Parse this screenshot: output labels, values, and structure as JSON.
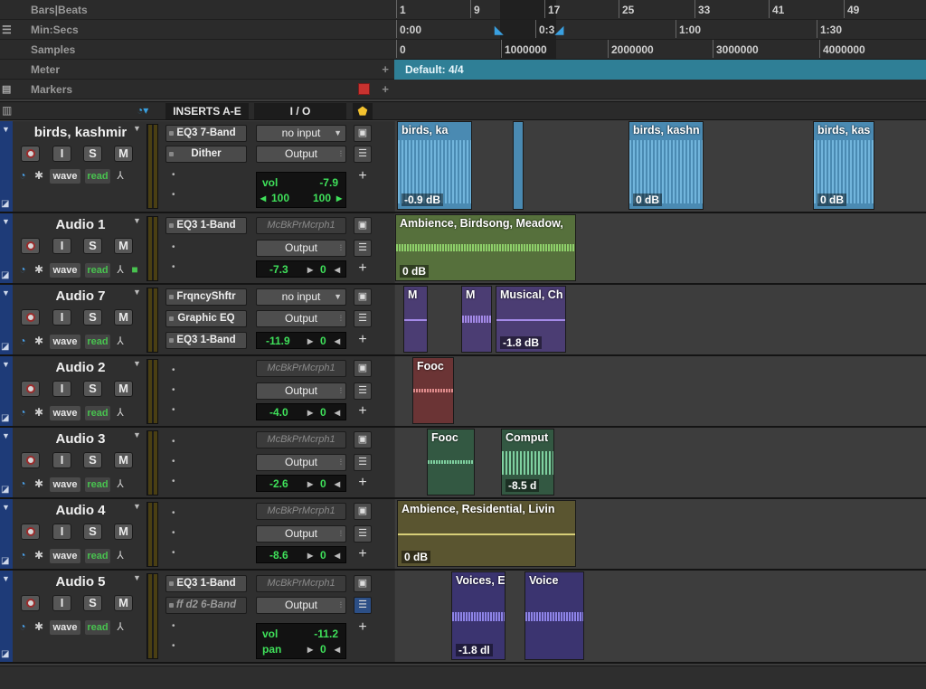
{
  "rulers": {
    "bars_beats": {
      "label": "Bars|Beats",
      "ticks": [
        "1",
        "9",
        "17",
        "25",
        "33",
        "41",
        "49"
      ]
    },
    "min_secs": {
      "label": "Min:Secs",
      "ticks": [
        "0:00",
        "0:3",
        "1:00",
        "1:30"
      ]
    },
    "samples": {
      "label": "Samples",
      "ticks": [
        "0",
        "1000000",
        "2000000",
        "3000000",
        "4000000"
      ]
    },
    "meter": {
      "label": "Meter",
      "value": "Default: 4/4"
    },
    "markers": {
      "label": "Markers"
    }
  },
  "header": {
    "inserts": "INSERTS A-E",
    "io": "I / O"
  },
  "colors": {
    "track_edge": "#1e3b78",
    "meter_bar": "#2f7f96",
    "vol_text": "#3fe05a",
    "read": "#48c34f"
  },
  "tracks": [
    {
      "name": "birds, kashmir",
      "inserts": [
        "EQ3 7-Band",
        "Dither"
      ],
      "input": "no input",
      "output": "Output",
      "vol_label": "vol",
      "vol": "-7.9",
      "pan_left": "100",
      "pan_right": "100",
      "view": "wave",
      "auto": "read",
      "clips": [
        {
          "name": "birds, ka",
          "gain": "-0.9 dB"
        },
        {
          "name": "birds, kashn",
          "gain": "0 dB"
        },
        {
          "name": "birds, kas",
          "gain": "0 dB"
        }
      ]
    },
    {
      "name": "Audio 1",
      "inserts": [
        "EQ3 1-Band"
      ],
      "input": "McBkPrMcrph1",
      "output": "Output",
      "vol": "-7.3",
      "pan": "0",
      "view": "wave",
      "auto": "read",
      "clips": [
        {
          "name": "Ambience, Birdsong, Meadow,",
          "gain": "0 dB"
        }
      ]
    },
    {
      "name": "Audio 7",
      "inserts": [
        "FrqncyShftr",
        "Graphic EQ",
        "EQ3 1-Band"
      ],
      "input": "no input",
      "output": "Output",
      "vol": "-11.9",
      "pan": "0",
      "view": "wave",
      "auto": "read",
      "clips": [
        {
          "name": "M",
          "gain": ""
        },
        {
          "name": "M",
          "gain": ""
        },
        {
          "name": "Musical, Ch",
          "gain": "-1.8 dB"
        }
      ]
    },
    {
      "name": "Audio 2",
      "inserts": [],
      "input": "McBkPrMcrph1",
      "output": "Output",
      "vol": "-4.0",
      "pan": "0",
      "view": "wave",
      "auto": "read",
      "clips": [
        {
          "name": "Fooc",
          "gain": ""
        }
      ]
    },
    {
      "name": "Audio 3",
      "inserts": [],
      "input": "McBkPrMcrph1",
      "output": "Output",
      "vol": "-2.6",
      "pan": "0",
      "view": "wave",
      "auto": "read",
      "clips": [
        {
          "name": "Fooc",
          "gain": ""
        },
        {
          "name": "Comput",
          "gain": "-8.5 d"
        }
      ]
    },
    {
      "name": "Audio 4",
      "inserts": [],
      "input": "McBkPrMcrph1",
      "output": "Output",
      "vol": "-8.6",
      "pan": "0",
      "view": "wave",
      "auto": "read",
      "clips": [
        {
          "name": "Ambience, Residential, Livin",
          "gain": "0 dB"
        }
      ]
    },
    {
      "name": "Audio 5",
      "inserts": [
        "EQ3 1-Band",
        "ff d2 6-Band"
      ],
      "input": "McBkPrMcrph1",
      "output": "Output",
      "vol_label": "vol",
      "vol": "-11.2",
      "pan_label": "pan",
      "pan": "0",
      "view": "wave",
      "auto": "read",
      "clips": [
        {
          "name": "Voices, E",
          "gain": "-1.8 dl"
        },
        {
          "name": "Voice",
          "gain": ""
        }
      ]
    }
  ]
}
